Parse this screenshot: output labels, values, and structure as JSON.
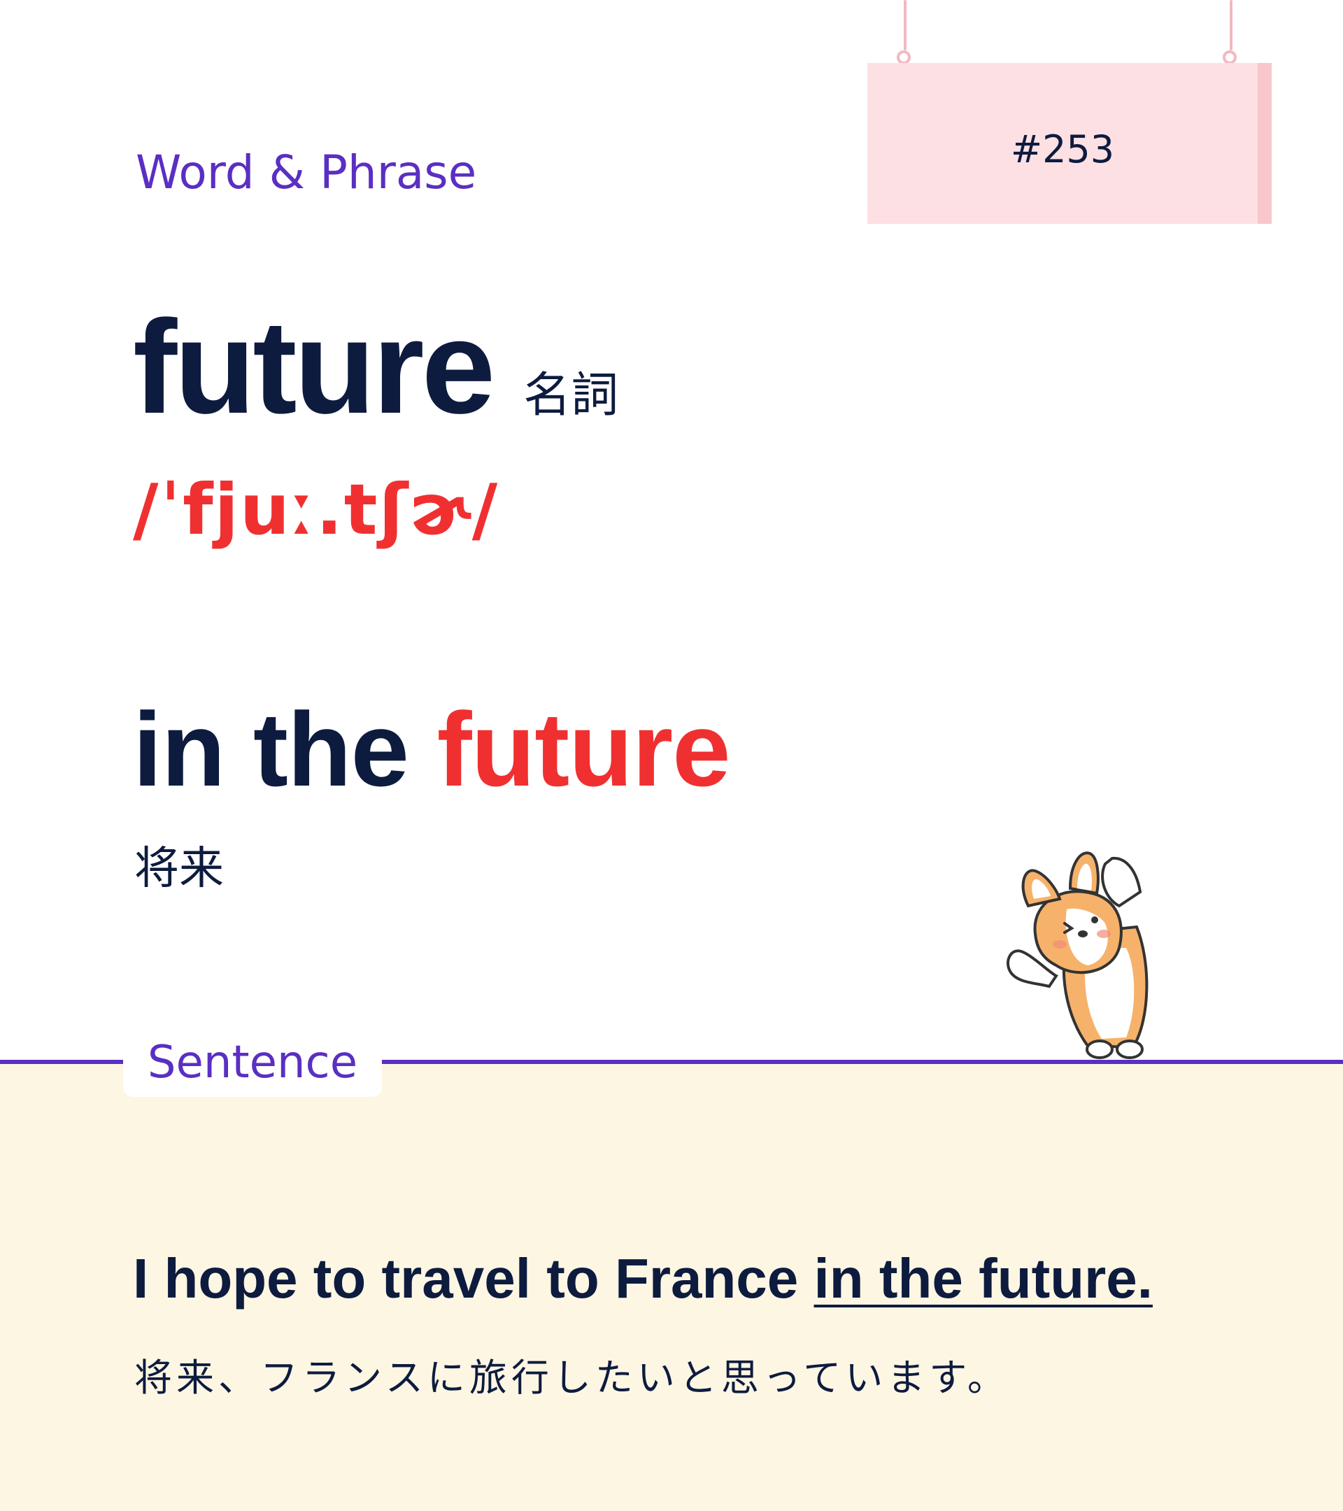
{
  "badge": {
    "number": "#253"
  },
  "header": {
    "category": "Word & Phrase"
  },
  "word": {
    "text": "future",
    "part_of_speech": "名詞",
    "pronunciation": "/ˈfjuː.tʃɚ/"
  },
  "phrase": {
    "prefix": "in the ",
    "highlight": "future",
    "translation": "将来"
  },
  "sentence": {
    "section_label": "Sentence",
    "english_prefix": "I hope to travel to France ",
    "english_underlined": "in the future.",
    "japanese": "将来、フランスに旅行したいと思っています。"
  },
  "colors": {
    "navy": "#0d1b3e",
    "accent_red": "#f03030",
    "purple": "#5a2fc2",
    "sign_pink": "#fde0e3",
    "sentence_bg": "#fdf6e3"
  },
  "mascot": {
    "icon": "corgi-stretching-icon"
  }
}
